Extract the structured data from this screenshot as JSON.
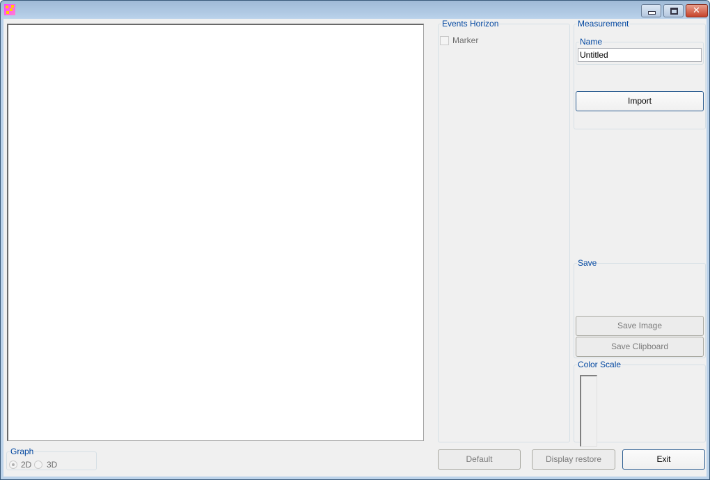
{
  "window": {
    "title": "",
    "icon": "app-icon",
    "controls": {
      "minimize": "minimize-icon",
      "maximize": "maximize-icon",
      "close": "close-icon"
    }
  },
  "events_horizon": {
    "title": "Events Horizon",
    "marker_label": "Marker",
    "marker_checked": false
  },
  "measurement": {
    "title": "Measurement",
    "name_group_title": "Name",
    "name_value": "Untitled",
    "import_label": "Import"
  },
  "save": {
    "title": "Save",
    "save_image_label": "Save Image",
    "save_clipboard_label": "Save Clipboard"
  },
  "color_scale": {
    "title": "Color Scale"
  },
  "graph": {
    "title": "Graph",
    "options": [
      {
        "label": "2D",
        "selected": true
      },
      {
        "label": "3D",
        "selected": false
      }
    ]
  },
  "footer": {
    "default_label": "Default",
    "display_restore_label": "Display restore",
    "exit_label": "Exit"
  }
}
